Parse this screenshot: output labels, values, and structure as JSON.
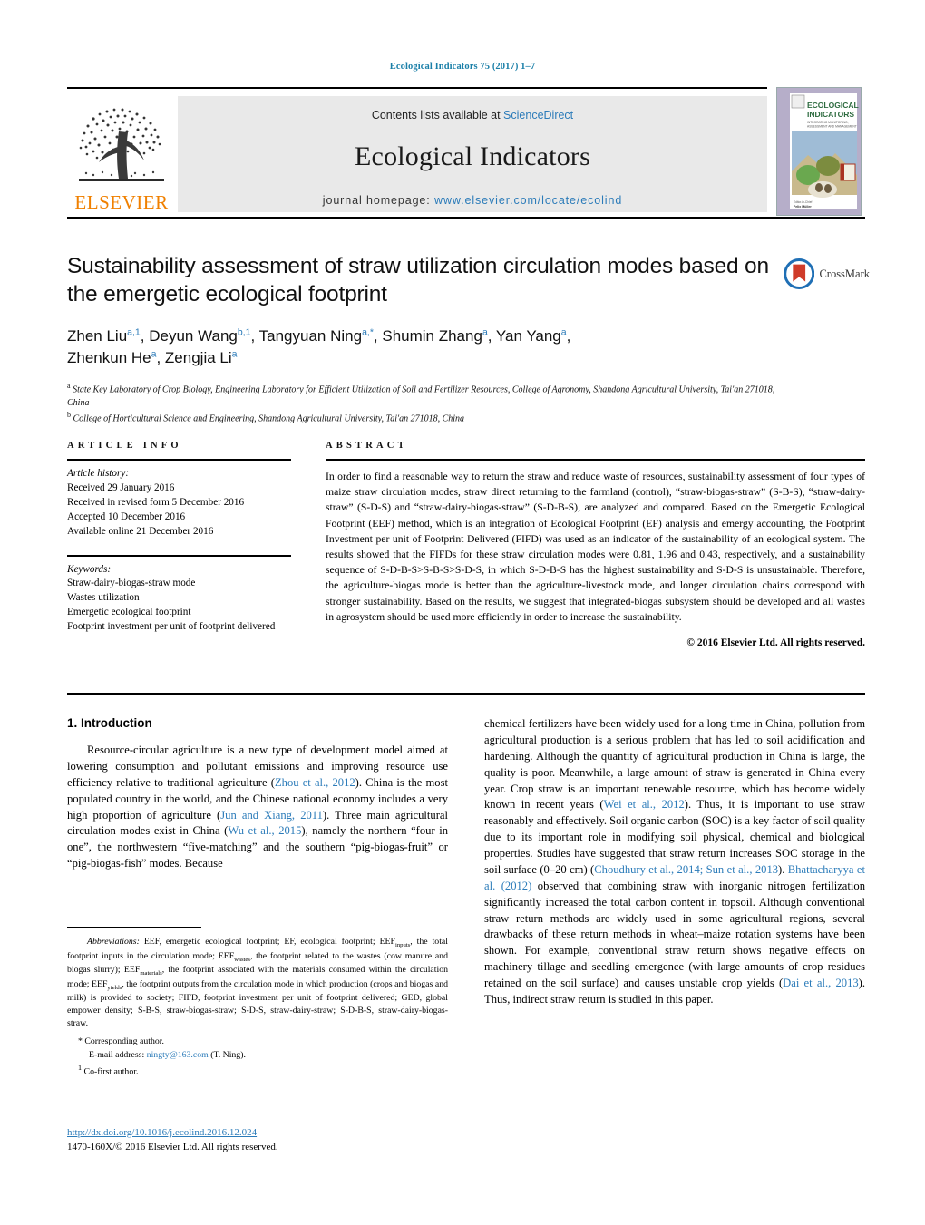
{
  "running_head": "Ecological Indicators 75 (2017) 1–7",
  "masthead": {
    "contents_prefix": "Contents lists available at ",
    "sciencedirect": "ScienceDirect",
    "journal_title": "Ecological Indicators",
    "homepage_label": "journal homepage: ",
    "homepage_url": "www.elsevier.com/locate/ecolind",
    "publisher_logo_text": "ELSEVIER",
    "cover_title_line1": "ECOLOGICAL",
    "cover_title_line2": "INDICATORS",
    "cover_subtitle": "INTEGRATING MONITORING, ASSESSMENT AND MANAGEMENT",
    "cover_footer": "Editor-in-Chief\nFelix Müller"
  },
  "article": {
    "title": "Sustainability assessment of straw utilization circulation modes based on the emergetic ecological footprint",
    "authors_line1": "Zhen Liu",
    "authors": [
      {
        "name": "Zhen Liu",
        "sup": "a,1"
      },
      {
        "name": "Deyun Wang",
        "sup": "b,1"
      },
      {
        "name": "Tangyuan Ning",
        "sup": "a,*"
      },
      {
        "name": "Shumin Zhang",
        "sup": "a"
      },
      {
        "name": "Yan Yang",
        "sup": "a"
      },
      {
        "name": "Zhenkun He",
        "sup": "a"
      },
      {
        "name": "Zengjia Li",
        "sup": "a"
      }
    ],
    "affiliations": [
      {
        "marker": "a",
        "text": "State Key Laboratory of Crop Biology, Engineering Laboratory for Efficient Utilization of Soil and Fertilizer Resources, College of Agronomy, Shandong Agricultural University, Tai'an 271018, China"
      },
      {
        "marker": "b",
        "text": "College of Horticultural Science and Engineering, Shandong Agricultural University, Tai'an 271018, China"
      }
    ],
    "crossmark_label": "CrossMark"
  },
  "article_info": {
    "heading": "ARTICLE INFO",
    "history_label": "Article history:",
    "history": [
      "Received 29 January 2016",
      "Received in revised form 5 December 2016",
      "Accepted 10 December 2016",
      "Available online 21 December 2016"
    ],
    "keywords_label": "Keywords:",
    "keywords": [
      "Straw-dairy-biogas-straw mode",
      "Wastes utilization",
      "Emergetic ecological footprint",
      "Footprint investment per unit of footprint delivered"
    ]
  },
  "abstract": {
    "heading": "ABSTRACT",
    "text": "In order to find a reasonable way to return the straw and reduce waste of resources, sustainability assessment of four types of maize straw circulation modes, straw direct returning to the farmland (control), “straw-biogas-straw” (S-B-S), “straw-dairy-straw” (S-D-S) and “straw-dairy-biogas-straw” (S-D-B-S), are analyzed and compared. Based on the Emergetic Ecological Footprint (EEF) method, which is an integration of Ecological Footprint (EF) analysis and emergy accounting, the Footprint Investment per unit of Footprint Delivered (FIFD) was used as an indicator of the sustainability of an ecological system. The results showed that the FIFDs for these straw circulation modes were 0.81, 1.96 and 0.43, respectively, and a sustainability sequence of S-D-B-S>S-B-S>S-D-S, in which S-D-B-S has the highest sustainability and S-D-S is unsustainable. Therefore, the agriculture-biogas mode is better than the agriculture-livestock mode, and longer circulation chains correspond with stronger sustainability. Based on the results, we suggest that integrated-biogas subsystem should be developed and all wastes in agrosystem should be used more efficiently in order to increase the sustainability.",
    "copyright": "© 2016 Elsevier Ltd. All rights reserved."
  },
  "introduction": {
    "heading": "1.  Introduction",
    "left_paragraph_parts": [
      {
        "t": "Resource-circular agriculture is a new type of development model aimed at lowering consumption and pollutant emissions and improving resource use efficiency relative to traditional agriculture (",
        "ref": false
      },
      {
        "t": "Zhou et al., 2012",
        "ref": true
      },
      {
        "t": "). China is the most populated country in the world, and the Chinese national economy includes a very high proportion of agriculture (",
        "ref": false
      },
      {
        "t": "Jun and Xiang, 2011",
        "ref": true
      },
      {
        "t": "). Three main agricultural circulation modes exist in China (",
        "ref": false
      },
      {
        "t": "Wu et al., 2015",
        "ref": true
      },
      {
        "t": "), namely the northern “four in one”, the northwestern “five-matching” and the southern “pig-biogas-fruit” or “pig-biogas-fish” modes. Because",
        "ref": false
      }
    ],
    "right_paragraph_parts": [
      {
        "t": "chemical fertilizers have been widely used for a long time in China, pollution from agricultural production is a serious problem that has led to soil acidification and hardening. Although the quantity of agricultural production in China is large, the quality is poor. Meanwhile, a large amount of straw is generated in China every year. Crop straw is an important renewable resource, which has become widely known in recent years (",
        "ref": false
      },
      {
        "t": "Wei et al., 2012",
        "ref": true
      },
      {
        "t": "). Thus, it is important to use straw reasonably and effectively. Soil organic carbon (SOC) is a key factor of soil quality due to its important role in modifying soil physical, chemical and biological properties. Studies have suggested that straw return increases SOC storage in the soil surface (0–20 cm) (",
        "ref": false
      },
      {
        "t": "Choudhury et al., 2014; Sun et al., 2013",
        "ref": true
      },
      {
        "t": "). ",
        "ref": false
      },
      {
        "t": "Bhattacharyya et al. (2012)",
        "ref": true
      },
      {
        "t": " observed that combining straw with inorganic nitrogen fertilization significantly increased the total carbon content in topsoil. Although conventional straw return methods are widely used in some agricultural regions, several drawbacks of these return methods in wheat–maize rotation systems have been shown. For example, conventional straw return shows negative effects on machinery tillage and seedling emergence (with large amounts of crop residues retained on the soil surface) and causes unstable crop yields (",
        "ref": false
      },
      {
        "t": "Dai et al., 2013",
        "ref": true
      },
      {
        "t": "). Thus, indirect straw return is studied in this paper.",
        "ref": false
      }
    ]
  },
  "footnotes": {
    "abbreviations_label": "Abbreviations:",
    "abbreviations_text": " EEF, emergetic ecological footprint; EF, ecological footprint; EEF<sub>inputs</sub>, the total footprint inputs in the circulation mode; EEF<sub>wastes</sub>, the footprint related to the wastes (cow manure and biogas slurry); EEF<sub>materials</sub>, the footprint associated with the materials consumed within the circulation mode; EEF<sub>yields</sub>, the footprint outputs from the circulation mode in which production (crops and biogas and milk) is provided to society; FIFD, footprint investment per unit of footprint delivered; GED, global empower density; S-B-S, straw-biogas-straw; S-D-S, straw-dairy-straw; S-D-B-S, straw-dairy-biogas-straw.",
    "corresponding_author": "* Corresponding author.",
    "email_label": "E-mail address:",
    "email": "ningty@163.com",
    "email_suffix": " (T. Ning).",
    "co_first_marker": "1",
    "co_first_author": "Co-first author.",
    "doi_url": "http://dx.doi.org/10.1016/j.ecolind.2016.12.024",
    "issn_line": "1470-160X/© 2016 Elsevier Ltd. All rights reserved."
  },
  "colors": {
    "link": "#2b7bb9",
    "elsevier_orange": "#F08000",
    "band_gray": "#e9e9e9"
  }
}
